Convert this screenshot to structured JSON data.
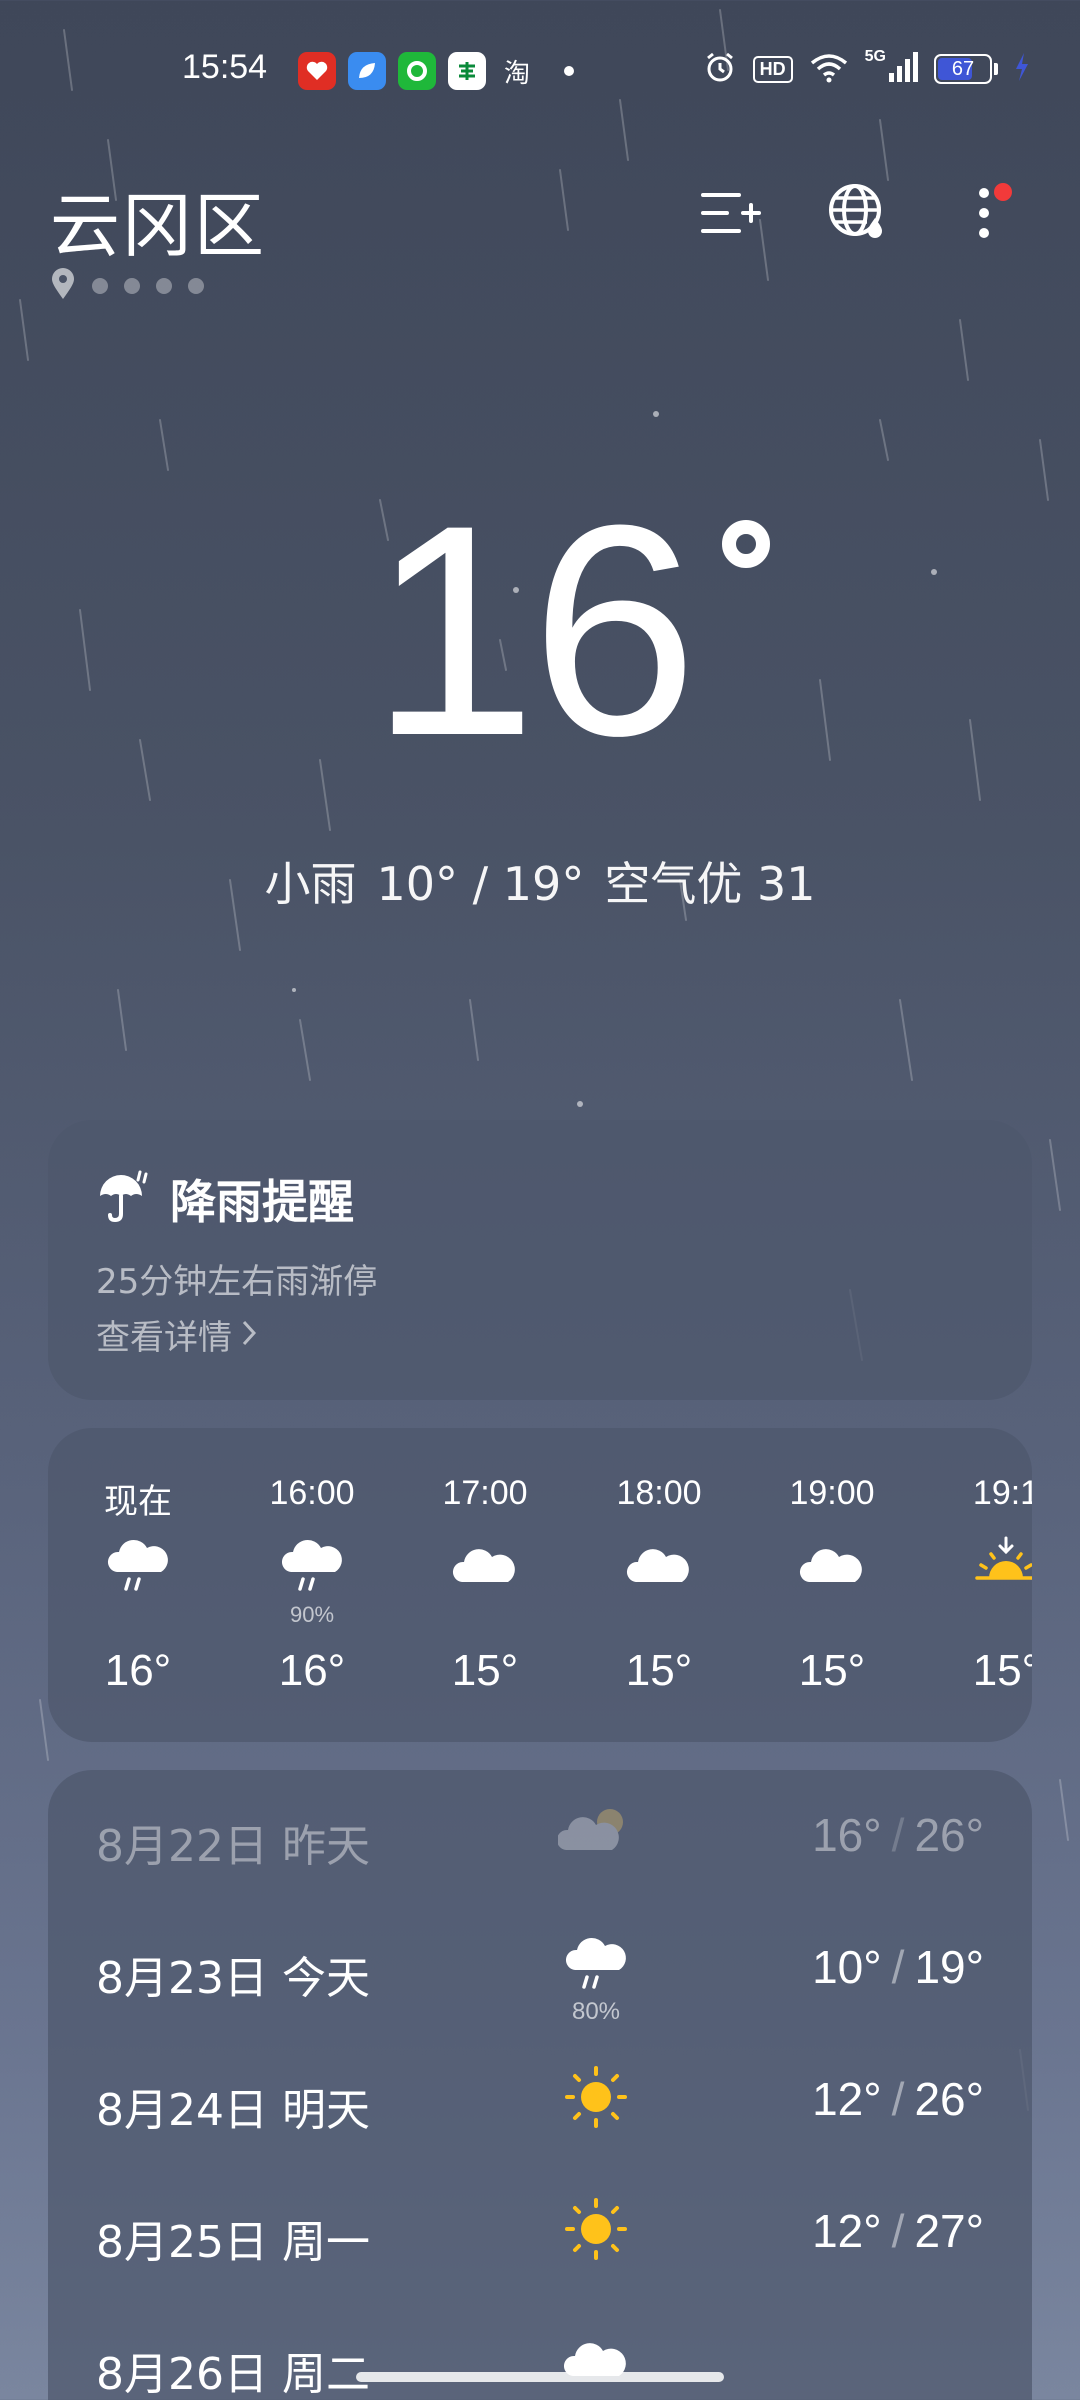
{
  "status_bar": {
    "time": "15:54",
    "apps": [
      {
        "name": "pinduoduo",
        "color": "#e02e24"
      },
      {
        "name": "meituan",
        "color": "#3a8cf0"
      },
      {
        "name": "alipay",
        "color": "#1fb83a"
      },
      {
        "name": "china-post",
        "color": "#ffffff"
      }
    ],
    "taobao": "淘",
    "hd": "HD",
    "network": "5G",
    "battery": "67",
    "battery_level": 0.67,
    "battery_fill_color": "#3f56d6"
  },
  "header": {
    "location": "云冈区",
    "page_count": 5,
    "active_page": 0
  },
  "current": {
    "temp": "16",
    "condition": "小雨",
    "range": "10° / 19°",
    "aqi": "空气优 31"
  },
  "rain_alert": {
    "title": "降雨提醒",
    "description": "25分钟左右雨渐停",
    "link": "查看详情"
  },
  "hourly": [
    {
      "time": "现在",
      "icon": "rain-icon",
      "prob": "",
      "temp": "16°"
    },
    {
      "time": "16:00",
      "icon": "rain-icon",
      "prob": "90%",
      "temp": "16°"
    },
    {
      "time": "17:00",
      "icon": "cloud-icon",
      "prob": "",
      "temp": "15°"
    },
    {
      "time": "18:00",
      "icon": "cloud-icon",
      "prob": "",
      "temp": "15°"
    },
    {
      "time": "19:00",
      "icon": "cloud-icon",
      "prob": "",
      "temp": "15°"
    },
    {
      "time": "19:1",
      "icon": "sunset-icon",
      "prob": "",
      "temp": "15°"
    }
  ],
  "daily": [
    {
      "date": "8月22日  昨天",
      "icon": "partly-cloudy-icon",
      "prob": "",
      "low": "16°",
      "high": "26°",
      "past": true
    },
    {
      "date": "8月23日  今天",
      "icon": "rain-icon",
      "prob": "80%",
      "low": "10°",
      "high": "19°",
      "past": false
    },
    {
      "date": "8月24日  明天",
      "icon": "sun-icon",
      "prob": "",
      "low": "12°",
      "high": "26°",
      "past": false
    },
    {
      "date": "8月25日  周一",
      "icon": "sun-icon",
      "prob": "",
      "low": "12°",
      "high": "27°",
      "past": false
    },
    {
      "date": "8月26日  周二",
      "icon": "cloud-icon",
      "prob": "",
      "low": "",
      "high": "",
      "past": false
    }
  ],
  "colors": {
    "sun": "#ffc21a",
    "notification": "#f23a3a"
  }
}
